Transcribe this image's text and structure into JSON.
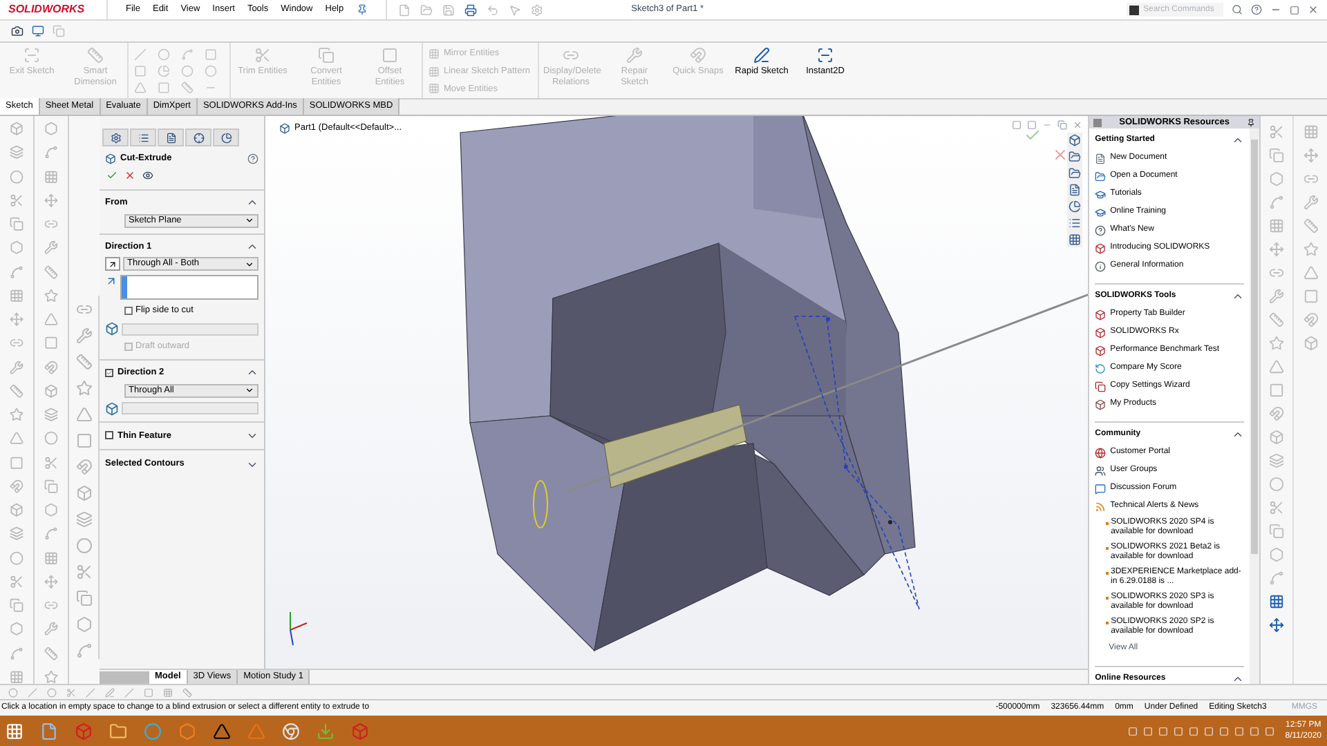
{
  "title_bar": {
    "logo": "SOLIDWORKS",
    "menus": [
      "File",
      "Edit",
      "View",
      "Insert",
      "Tools",
      "Window",
      "Help"
    ],
    "title": "Sketch3 of Part1 *",
    "search": {
      "placeholder": "Search Commands"
    }
  },
  "ribbon": {
    "large_commands": [
      {
        "label": "Exit Sketch",
        "disabled": true
      },
      {
        "label": "Smart Dimension",
        "disabled": true
      }
    ],
    "middle_commands": [
      {
        "label": "Trim Entities",
        "disabled": true
      },
      {
        "label": "Convert Entities",
        "disabled": true
      },
      {
        "label": "Offset Entities",
        "disabled": true
      }
    ],
    "small_commands": [
      {
        "label": "Mirror Entities",
        "disabled": true
      },
      {
        "label": "Linear Sketch Pattern",
        "disabled": true
      },
      {
        "label": "Move Entities",
        "disabled": true
      }
    ],
    "right_commands": [
      {
        "label": "Display/Delete Relations",
        "disabled": true
      },
      {
        "label": "Repair Sketch",
        "disabled": true
      },
      {
        "label": "Quick Snaps",
        "disabled": true
      },
      {
        "label": "Rapid Sketch",
        "disabled": false
      },
      {
        "label": "Instant2D",
        "disabled": false
      }
    ]
  },
  "tabs": [
    {
      "label": "Sketch",
      "selected": true
    },
    {
      "label": "Sheet Metal",
      "selected": false
    },
    {
      "label": "Evaluate",
      "selected": false
    },
    {
      "label": "DimXpert",
      "selected": false
    },
    {
      "label": "SOLIDWORKS Add-Ins",
      "selected": false
    },
    {
      "label": "SOLIDWORKS MBD",
      "selected": false
    }
  ],
  "property_manager": {
    "title": "Cut-Extrude",
    "from": {
      "label": "From",
      "value": "Sketch Plane"
    },
    "direction_1": {
      "label": "Direction 1",
      "end_condition": "Through All - Both",
      "flip_side": {
        "label": "Flip side to cut",
        "checked": false
      },
      "draft": {
        "label": "Draft outward",
        "checked": false,
        "disabled": true
      }
    },
    "direction_2": {
      "label": "Direction 2",
      "checked": true,
      "end_condition": "Through All"
    },
    "thin_feature": {
      "label": "Thin Feature",
      "checked": false
    },
    "selected_contours": {
      "label": "Selected Contours"
    }
  },
  "feature_tree": {
    "root": "Part1  (Default<<Default>..."
  },
  "resources": {
    "title": "SOLIDWORKS Resources",
    "sections": [
      {
        "title": "Getting Started",
        "items": [
          "New Document",
          "Open a Document",
          "Tutorials",
          "Online Training",
          "What's New",
          "Introducing SOLIDWORKS",
          "General Information"
        ]
      },
      {
        "title": "SOLIDWORKS Tools",
        "items": [
          "Property Tab Builder",
          "SOLIDWORKS Rx",
          "Performance Benchmark Test",
          "Compare My Score",
          "Copy Settings Wizard",
          "My Products"
        ]
      },
      {
        "title": "Community",
        "items": [
          "Customer Portal",
          "User Groups",
          "Discussion Forum",
          "Technical Alerts & News"
        ],
        "news": [
          "SOLIDWORKS 2020 SP4 is available for download",
          "SOLIDWORKS 2021 Beta2 is available for download",
          "3DEXPERIENCE Marketplace add-in 6.29.0188 is ...",
          "SOLIDWORKS 2020 SP3 is available for download",
          "SOLIDWORKS 2020 SP2 is available for download"
        ],
        "view_all": "View All"
      },
      {
        "title": "Online Resources"
      }
    ]
  },
  "bottom_tabs": [
    {
      "label": "Model",
      "selected": true
    },
    {
      "label": "3D Views",
      "selected": false
    },
    {
      "label": "Motion Study 1",
      "selected": false
    }
  ],
  "status_bar": {
    "message": "Click a location in empty space to change to a blind extrusion or select a different entity to extrude to",
    "fields": [
      "-500000mm",
      "323656.44mm",
      "0mm",
      "Under Defined",
      "Editing Sketch3",
      "MMGS"
    ]
  },
  "taskbar": {
    "time": "12:57 PM",
    "date": "8/11/2020"
  }
}
